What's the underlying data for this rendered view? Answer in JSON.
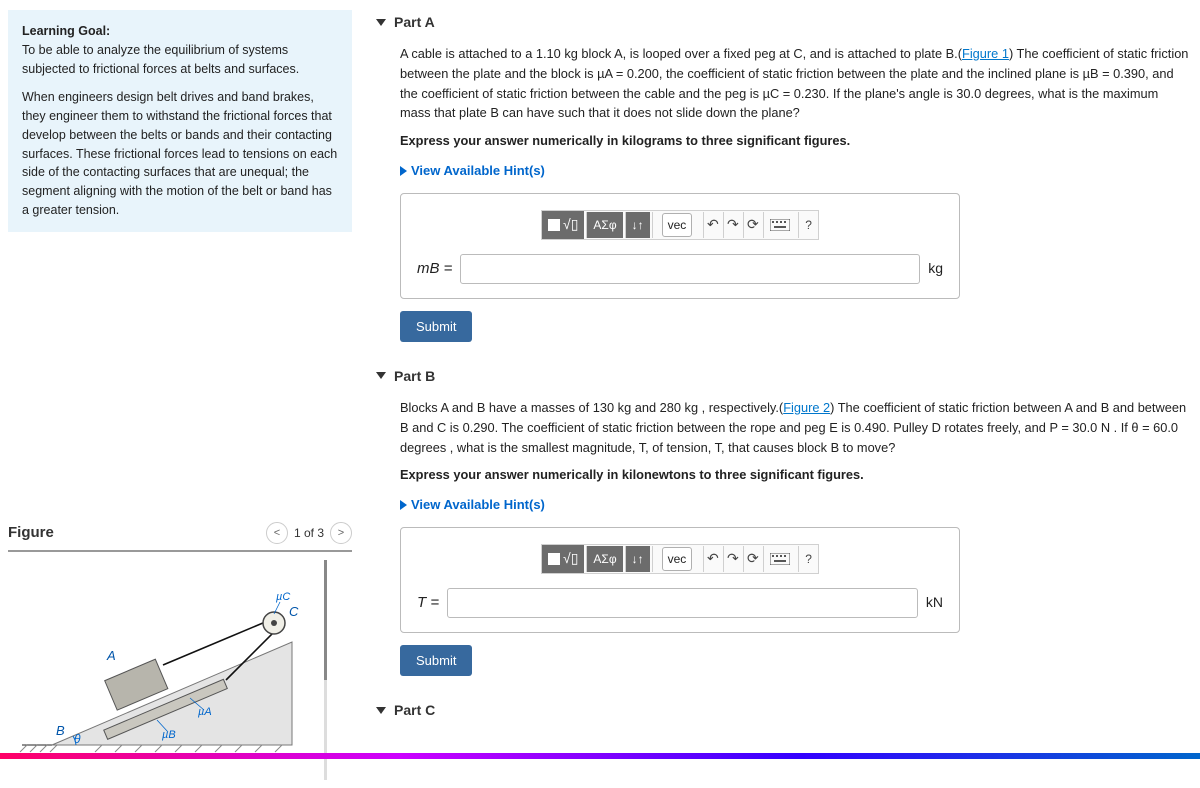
{
  "learning_goal": {
    "title": "Learning Goal:",
    "p1": "To be able to analyze the equilibrium of systems subjected to frictional forces at belts and surfaces.",
    "p2": "When engineers design belt drives and band brakes, they engineer them to withstand the frictional forces that develop between the belts or bands and their contacting surfaces. These frictional forces lead to tensions on each side of the contacting surfaces that are unequal; the segment aligning with the motion of the belt or band has a greater tension."
  },
  "figure": {
    "title": "Figure",
    "page": "1 of 3",
    "labels": {
      "A": "A",
      "B": "B",
      "C": "C",
      "muA": "µA",
      "muB": "µB",
      "muC": "µC",
      "theta": "θ"
    }
  },
  "partA": {
    "title": "Part A",
    "text_pre": "A cable is attached to a 1.10 kg block A, is looped over a fixed peg at C, and is attached to plate B.(",
    "fig_link": "Figure 1",
    "text_post": ") The coefficient of static friction between the plate and the block is µA = 0.200, the coefficient of static friction between the plate and the inclined plane is µB = 0.390, and the coefficient of static friction between the cable and the peg is µC = 0.230. If the plane's angle is 30.0 degrees, what is the maximum mass that plate B can have such that it does not slide down the plane?",
    "express": "Express your answer numerically in kilograms to three significant figures.",
    "hints": "View Available Hint(s)",
    "var": "mB =",
    "unit": "kg",
    "submit": "Submit"
  },
  "partB": {
    "title": "Part B",
    "text_pre": "Blocks A and B have a masses of 130 kg and 280 kg , respectively.(",
    "fig_link": "Figure 2",
    "text_post": ") The coefficient of static friction between A and B and between B and C is 0.290. The coefficient of static friction between the rope and peg E is 0.490. Pulley D rotates freely, and P = 30.0 N . If θ = 60.0 degrees , what is the smallest magnitude, T, of tension, T, that causes block B to move?",
    "express": "Express your answer numerically in kilonewtons to three significant figures.",
    "hints": "View Available Hint(s)",
    "var": "T =",
    "unit": "kN",
    "submit": "Submit"
  },
  "partC": {
    "title": "Part C"
  },
  "toolbar": {
    "sigma": "ΑΣφ",
    "updown": "↓↑",
    "vec": "vec",
    "undo": "↶",
    "redo": "↷",
    "reset": "⟳",
    "help": "?"
  }
}
